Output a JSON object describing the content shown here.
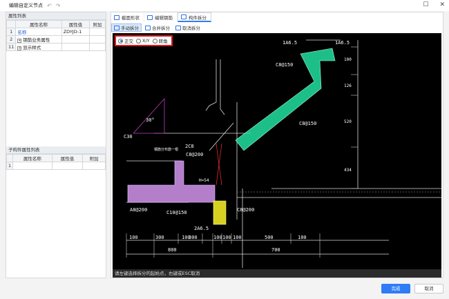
{
  "window": {
    "title": "编辑自定义节点"
  },
  "attr_panel": {
    "title": "属性列表",
    "headers": [
      "属性名称",
      "属性值",
      "附加"
    ],
    "rows": [
      {
        "idx": "1",
        "name": "名称",
        "value": "ZDYJD-1",
        "extra": ""
      },
      {
        "idx": "2",
        "name": "钢筋业务属性",
        "value": "",
        "extra": ""
      },
      {
        "idx": "11",
        "name": "显示样式",
        "value": "",
        "extra": ""
      }
    ]
  },
  "sub_panel": {
    "title": "子构件属性列表",
    "headers": [
      "属性名称",
      "属性值",
      "附加"
    ],
    "rows": [
      {
        "idx": "1",
        "name": "",
        "value": "",
        "extra": ""
      }
    ]
  },
  "tabs": [
    {
      "label": "截面形状"
    },
    {
      "label": "编辑钢筋"
    },
    {
      "label": "构件拆分"
    }
  ],
  "toolbar": {
    "manual": "手动拆分",
    "merge": "合并拆分",
    "cancel": "取消拆分"
  },
  "mode": {
    "orth": "正交",
    "xy": "X/Y",
    "rotate": "转角"
  },
  "drawing": {
    "labels": {
      "top1": "1A6.5",
      "top2": "1A6.5",
      "c8_150a": "C8@150",
      "c8_150b": "C8@150",
      "c30": "C30",
      "c8_200a": "C8@200",
      "c2c8": "2C8",
      "a8": "A8@200",
      "c10": "C10@150",
      "c8_200b": "C8@200",
      "a65": "2A6.5",
      "hs": "H=54",
      "dim_v1": "100",
      "dim_v2": "126",
      "dim_v3": "520",
      "dim_v4": "434",
      "angle": "30°",
      "note": "钢筋分布筋一根"
    },
    "dims_bottom": [
      "100",
      "300",
      "100",
      "300",
      "100",
      "100",
      "100",
      "500",
      "100"
    ],
    "dims_total": [
      "800",
      "700"
    ]
  },
  "status": "请左键选择拆分的起始点，右键或ESC取消",
  "buttons": {
    "ok": "完成",
    "cancel": "取消"
  }
}
